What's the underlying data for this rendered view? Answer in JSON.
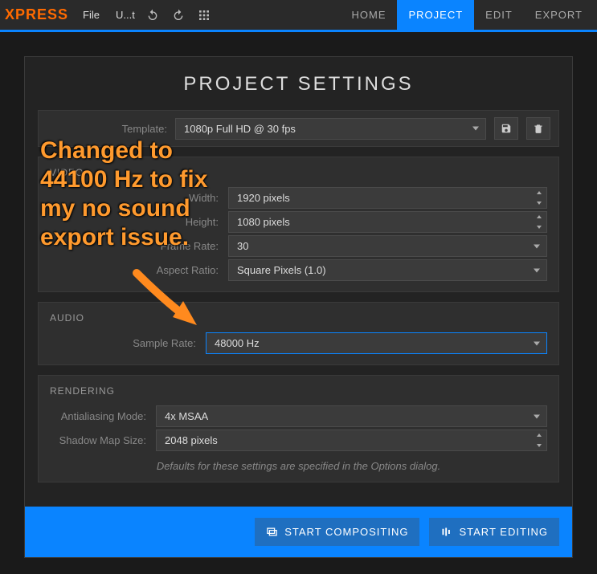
{
  "brand": "XPRESS",
  "menu": {
    "file": "File",
    "save": "U...t"
  },
  "tabs": {
    "home": "HOME",
    "project": "PROJECT",
    "edit": "EDIT",
    "export": "EXPORT"
  },
  "title": "PROJECT SETTINGS",
  "template": {
    "label": "Template:",
    "value": "1080p Full HD @ 30 fps"
  },
  "video": {
    "head": "VIDEO",
    "width_label": "Width:",
    "width": "1920 pixels",
    "height_label": "Height:",
    "height": "1080 pixels",
    "fps_label": "Frame Rate:",
    "fps": "30",
    "aspect_label": "Aspect Ratio:",
    "aspect": "Square Pixels (1.0)"
  },
  "audio": {
    "head": "AUDIO",
    "sample_label": "Sample Rate:",
    "sample": "48000 Hz"
  },
  "rendering": {
    "head": "RENDERING",
    "aa_label": "Antialiasing Mode:",
    "aa": "4x MSAA",
    "shadow_label": "Shadow Map Size:",
    "shadow": "2048 pixels",
    "note": "Defaults for these settings are specified in the Options dialog."
  },
  "footer": {
    "compositing": "START COMPOSITING",
    "editing": "START EDITING"
  },
  "annotation": "Changed to 44100 Hz to fix my no sound export issue."
}
